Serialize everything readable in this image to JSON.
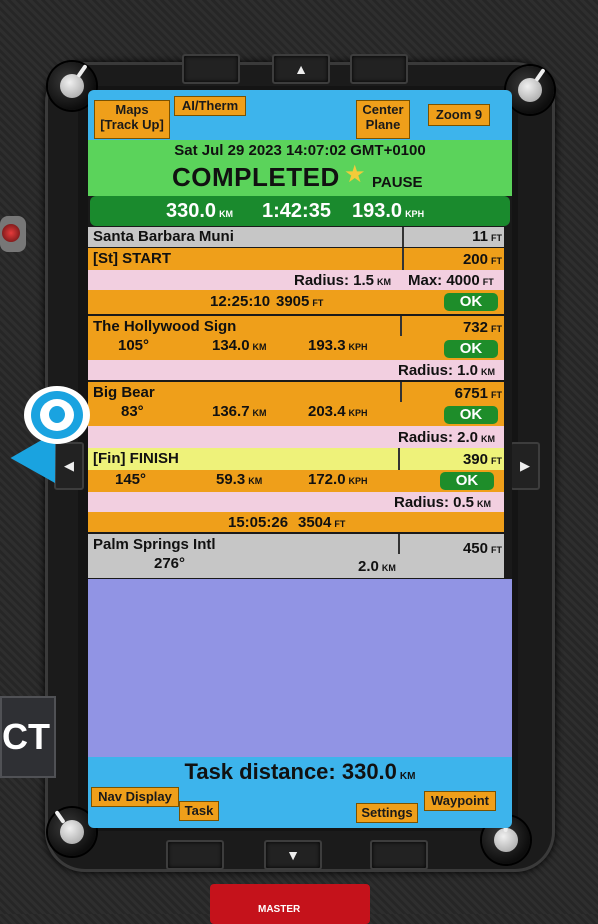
{
  "topbar": {
    "maps_label_1": "Maps",
    "maps_label_2": "[Track Up]",
    "aitherm_label": "AI/Therm",
    "center_label_1": "Center",
    "center_label_2": "Plane",
    "zoom_label": "Zoom 9"
  },
  "status": {
    "datetime": "Sat Jul 29 2023 14:07:02 GMT+0100",
    "state": "COMPLETED",
    "pause_label": "PAUSE"
  },
  "stats": {
    "distance": "330.0",
    "distance_unit": "KM",
    "time": "1:42:35",
    "speed": "193.0",
    "speed_unit": "KPH"
  },
  "waypoints": [
    {
      "name": "Santa Barbara Muni",
      "elev": "11",
      "elev_unit": "FT"
    },
    {
      "name": "[St] START",
      "elev": "200",
      "elev_unit": "FT",
      "radius": "Radius: 1.5",
      "radius_unit": "KM",
      "max": "Max: 4000",
      "max_unit": "FT",
      "ok": "OK",
      "time": "12:25:10",
      "alt": "3905",
      "alt_unit": "FT"
    },
    {
      "name": "The Hollywood Sign",
      "elev": "732",
      "elev_unit": "FT",
      "bearing": "105°",
      "dist": "134.0",
      "dist_unit": "KM",
      "speed": "193.3",
      "speed_unit": "KPH",
      "ok": "OK",
      "radius": "Radius: 1.0",
      "radius_unit": "KM"
    },
    {
      "name": "Big Bear",
      "elev": "6751",
      "elev_unit": "FT",
      "bearing": "83°",
      "dist": "136.7",
      "dist_unit": "KM",
      "speed": "203.4",
      "speed_unit": "KPH",
      "ok": "OK",
      "radius": "Radius: 2.0",
      "radius_unit": "KM"
    },
    {
      "name": "[Fin] FINISH",
      "elev": "390",
      "elev_unit": "FT",
      "bearing": "145°",
      "dist": "59.3",
      "dist_unit": "KM",
      "speed": "172.0",
      "speed_unit": "KPH",
      "ok": "OK",
      "radius": "Radius: 0.5",
      "radius_unit": "KM",
      "time": "15:05:26",
      "alt": "3504",
      "alt_unit": "FT"
    },
    {
      "name": "Palm Springs Intl",
      "elev": "450",
      "elev_unit": "FT",
      "bearing": "276°",
      "dist": "2.0",
      "dist_unit": "KM"
    }
  ],
  "footer": {
    "task_distance": "Task distance: 330.0",
    "task_distance_unit": "KM",
    "nav_display": "Nav Display",
    "task": "Task",
    "settings": "Settings",
    "waypoint": "Waypoint"
  },
  "hardware": {
    "up_arrow": "▲",
    "down_arrow": "▼",
    "left_arrow": "◀",
    "right_arrow": "▶",
    "side_label": "CT",
    "master_label": "MASTER"
  },
  "colors": {
    "screen_blue": "#3db4ec",
    "status_green": "#5bd35b",
    "stats_green": "#1a8a2d",
    "orange": "#ef9f1a",
    "pink": "#f2cfe0",
    "grey": "#c6c6c6",
    "finish_yellow": "#eef27a",
    "map_lavender": "#9194e4"
  }
}
